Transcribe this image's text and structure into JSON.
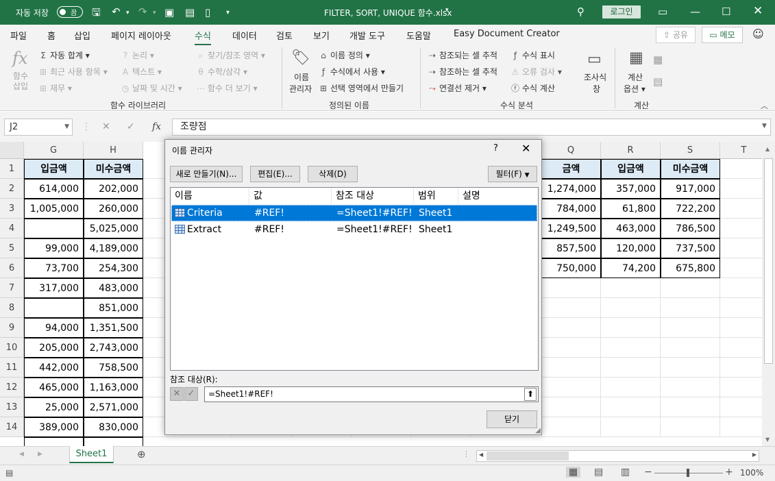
{
  "titlebar": {
    "autosave_label": "자동 저장",
    "autosave_state": "끔",
    "filename": "FILTER, SORT, UNIQUE 함수.xlsx",
    "login_label": "로그인"
  },
  "menu": {
    "items": [
      "파일",
      "홈",
      "삽입",
      "페이지 레이아웃",
      "수식",
      "데이터",
      "검토",
      "보기",
      "개발 도구",
      "도움말",
      "Easy Document Creator"
    ],
    "active": "수식",
    "share_label": "공유",
    "memo_label": "메모"
  },
  "ribbon": {
    "function_library": {
      "insert_function": "함수 삽입",
      "autosum": "자동 합계",
      "recent": "최근 사용 항목",
      "financial": "재무",
      "logical": "논리",
      "text": "텍스트",
      "datetime": "날짜 및 시간",
      "lookup": "찾기/참조 영역",
      "math": "수학/삼각",
      "more": "함수 더 보기",
      "group_label": "함수 라이브러리"
    },
    "defined_names": {
      "name_manager_1": "이름",
      "name_manager_2": "관리자",
      "define_name": "이름 정의",
      "use_in_formula": "수식에서 사용",
      "create_from_selection": "선택 영역에서 만들기",
      "group_label": "정의된 이름"
    },
    "formula_auditing": {
      "trace_precedents": "참조되는 셀 추적",
      "trace_dependents": "참조하는 셀 추적",
      "remove_arrows": "연결선 제거",
      "show_formulas": "수식 표시",
      "error_checking": "오류 검사",
      "evaluate_formula": "수식 계산",
      "watch_window_1": "조사식",
      "watch_window_2": "창",
      "group_label": "수식 분석"
    },
    "calculation": {
      "options_1": "계산",
      "options_2": "옵션",
      "group_label": "계산"
    }
  },
  "formula_bar": {
    "name_box": "J2",
    "fx": "fx",
    "content": "조량점"
  },
  "grid": {
    "columns_left": [
      "G",
      "H"
    ],
    "columns_right": [
      "Q",
      "R",
      "S",
      "T"
    ],
    "rows": [
      "1",
      "2",
      "3",
      "4",
      "5",
      "6",
      "7",
      "8",
      "9",
      "10",
      "11",
      "12",
      "13",
      "14"
    ],
    "left_header": [
      "입금액",
      "미수금액"
    ],
    "left_values": [
      [
        "614,000",
        "202,000"
      ],
      [
        "1,005,000",
        "260,000"
      ],
      [
        "",
        "5,025,000"
      ],
      [
        "99,000",
        "4,189,000"
      ],
      [
        "73,700",
        "254,300"
      ],
      [
        "317,000",
        "483,000"
      ],
      [
        "",
        "851,000"
      ],
      [
        "94,000",
        "1,351,500"
      ],
      [
        "205,000",
        "2,743,000"
      ],
      [
        "442,000",
        "758,500"
      ],
      [
        "465,000",
        "1,163,000"
      ],
      [
        "25,000",
        "2,571,000"
      ],
      [
        "389,000",
        "830,000"
      ]
    ],
    "right_header": [
      "금액",
      "입금액",
      "미수금액"
    ],
    "right_values": [
      [
        "1,274,000",
        "357,000",
        "917,000"
      ],
      [
        "784,000",
        "61,800",
        "722,200"
      ],
      [
        "1,249,500",
        "463,000",
        "786,500"
      ],
      [
        "857,500",
        "120,000",
        "737,500"
      ],
      [
        "750,000",
        "74,200",
        "675,800"
      ]
    ]
  },
  "sheet_tabs": [
    "Sheet1"
  ],
  "status": {
    "zoom": "100%"
  },
  "dialog": {
    "title": "이름 관리자",
    "help": "?",
    "new_button": "새로 만들기(N)...",
    "edit_button": "편집(E)...",
    "delete_button": "삭제(D)",
    "filter_button": "필터(F)",
    "columns": [
      "이름",
      "값",
      "참조 대상",
      "범위",
      "설명"
    ],
    "rows": [
      {
        "name": "Criteria",
        "value": "#REF!",
        "refers_to": "=Sheet1!#REF!",
        "scope": "Sheet1",
        "comment": ""
      },
      {
        "name": "Extract",
        "value": "#REF!",
        "refers_to": "=Sheet1!#REF!",
        "scope": "Sheet1",
        "comment": ""
      }
    ],
    "refers_to_label": "참조 대상(R):",
    "refers_to_value": "=Sheet1!#REF!",
    "close_button": "닫기"
  }
}
